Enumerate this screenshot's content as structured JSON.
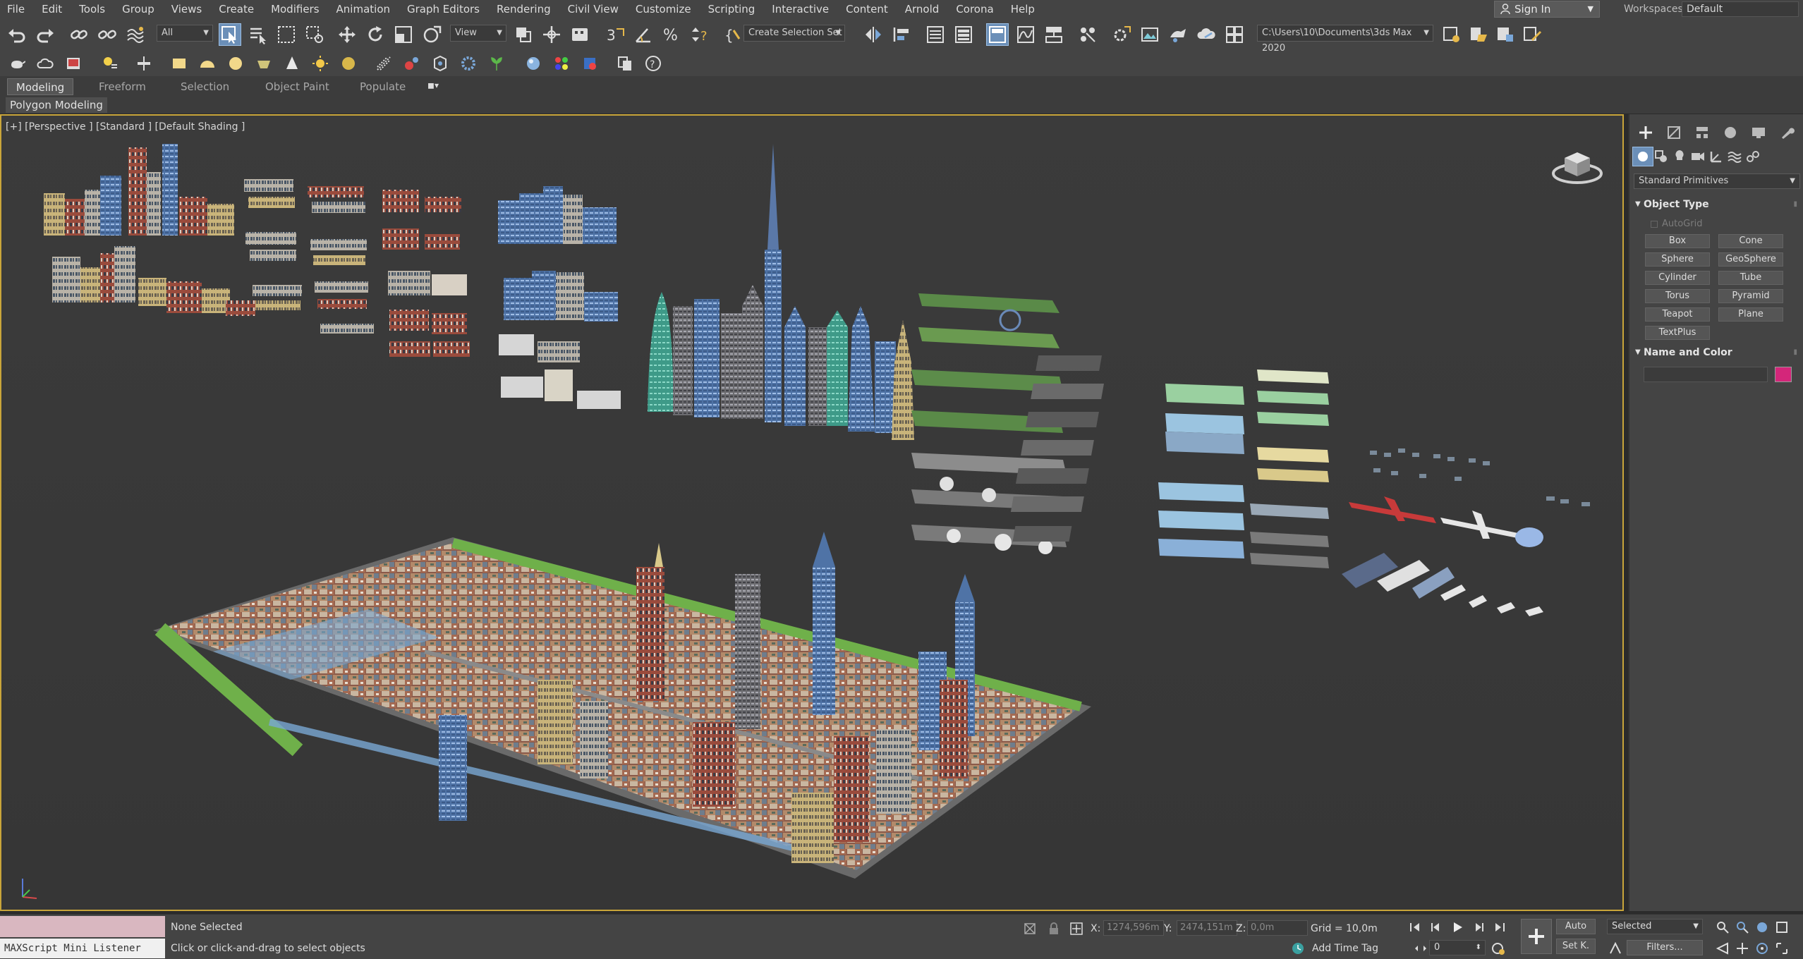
{
  "menubar": {
    "items": [
      "File",
      "Edit",
      "Tools",
      "Group",
      "Views",
      "Create",
      "Modifiers",
      "Animation",
      "Graph Editors",
      "Rendering",
      "Civil View",
      "Customize",
      "Scripting",
      "Interactive",
      "Content",
      "Arnold",
      "Corona",
      "Help"
    ],
    "signin": "Sign In",
    "workspaces_label": "Workspaces:",
    "workspace_value": "Default"
  },
  "toolbar": {
    "filter_value": "All",
    "refcoord_value": "View",
    "selection_set_placeholder": "Create Selection Set",
    "project_path": "C:\\Users\\10\\Documents\\3ds Max 2020"
  },
  "ribbon": {
    "tabs": [
      "Modeling",
      "Freeform",
      "Selection",
      "Object Paint",
      "Populate"
    ],
    "active_tab": "Modeling",
    "sub_label": "Polygon Modeling"
  },
  "viewport": {
    "label": "[+] [Perspective ] [Standard ] [Default Shading ]",
    "scene": "city asset library: building kits, skyscrapers, park tiles, road tiles, aircraft, ships and a complete city block layout"
  },
  "command_panel": {
    "category": "Standard Primitives",
    "object_type_title": "Object Type",
    "autogrid": "AutoGrid",
    "primitives": [
      "Box",
      "Cone",
      "Sphere",
      "GeoSphere",
      "Cylinder",
      "Tube",
      "Torus",
      "Pyramid",
      "Teapot",
      "Plane",
      "TextPlus"
    ],
    "name_color_title": "Name and Color",
    "object_color": "#d4267a"
  },
  "statusbar": {
    "maxscript_label": "MAXScript Mini Listener",
    "selection_status": "None Selected",
    "hint": "Click or click-and-drag to select objects",
    "x_label": "X:",
    "x_value": "1274,596m",
    "y_label": "Y:",
    "y_value": "2474,151m",
    "z_label": "Z:",
    "z_value": "0,0m",
    "grid": "Grid = 10,0m",
    "time_tag": "Add Time Tag",
    "auto_key": "Auto",
    "set_key": "Set K.",
    "key_filter_value": "Selected",
    "frame_value": "0",
    "filters": "Filters..."
  }
}
